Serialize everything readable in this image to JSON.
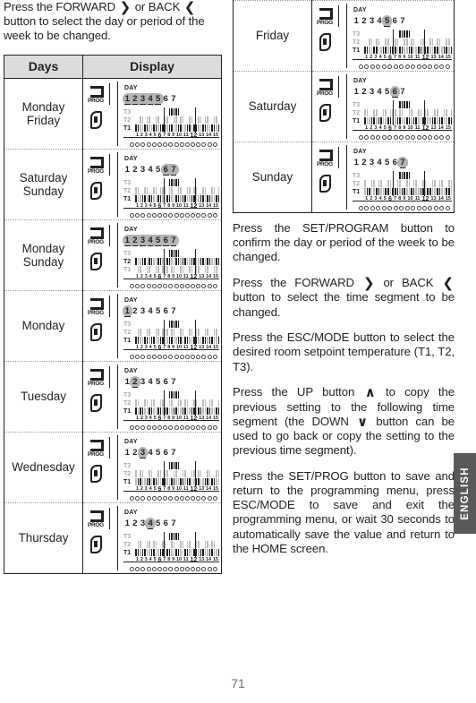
{
  "page_number": "71",
  "side_tab": {
    "label": "ENGLISH"
  },
  "left_column": {
    "intro_paragraph": {
      "part1": "Press the FORWARD",
      "icon_forward": "❯",
      "part2": "or BACK",
      "icon_back": "❮",
      "part3": "button to select the day or period of the week to be changed."
    },
    "table": {
      "headers": {
        "days": "Days",
        "display": "Display"
      },
      "rows": [
        {
          "days": "Monday\nFriday",
          "day_lines": [
            "Monday",
            "Friday"
          ],
          "display": {
            "prog_icon_label": "PROG",
            "day_label": "DAY",
            "day_numbers": [
              "1",
              "2",
              "3",
              "4",
              "5",
              "6",
              "7"
            ],
            "highlighted_days": [
              1,
              2,
              3,
              4,
              5
            ],
            "active_row": "T1",
            "rows": [
              "T3",
              "T2",
              "T1"
            ],
            "hour_ticks": [
              "1",
              "2",
              "3",
              "4",
              "5",
              "6",
              "7",
              "8",
              "9",
              "10",
              "11",
              "12",
              "13",
              "14",
              "15"
            ],
            "marker_hours": [
              "6",
              "12"
            ]
          }
        },
        {
          "days": "Saturday\nSunday",
          "day_lines": [
            "Saturday",
            "Sunday"
          ],
          "display": {
            "prog_icon_label": "PROG",
            "day_label": "DAY",
            "day_numbers": [
              "1",
              "2",
              "3",
              "4",
              "5",
              "6",
              "7"
            ],
            "highlighted_days": [
              6,
              7
            ],
            "active_row": "T1",
            "rows": [
              "T3",
              "T2",
              "T1"
            ],
            "hour_ticks": [
              "1",
              "2",
              "3",
              "4",
              "5",
              "6",
              "7",
              "8",
              "9",
              "10",
              "11",
              "12",
              "13",
              "14",
              "15"
            ],
            "marker_hours": [
              "6",
              "12"
            ]
          }
        },
        {
          "days": "Monday\nSunday",
          "day_lines": [
            "Monday",
            "Sunday"
          ],
          "display": {
            "prog_icon_label": "PROG",
            "day_label": "DAY",
            "day_numbers": [
              "1",
              "2",
              "3",
              "4",
              "5",
              "6",
              "7"
            ],
            "highlighted_days": [
              1,
              2,
              3,
              4,
              5,
              6,
              7
            ],
            "active_row": "T2",
            "rows": [
              "T3",
              "T2",
              "T1"
            ],
            "hour_ticks": [
              "1",
              "2",
              "3",
              "4",
              "5",
              "6",
              "7",
              "8",
              "9",
              "10",
              "11",
              "12",
              "13",
              "14",
              "15"
            ],
            "marker_hours": [
              "6",
              "12"
            ]
          }
        },
        {
          "days": "Monday",
          "day_lines": [
            "Monday"
          ],
          "display": {
            "prog_icon_label": "PROG",
            "day_label": "DAY",
            "day_numbers": [
              "1",
              "2",
              "3",
              "4",
              "5",
              "6",
              "7"
            ],
            "highlighted_days": [
              1
            ],
            "active_row": "T1",
            "rows": [
              "T3",
              "T2",
              "T1"
            ],
            "hour_ticks": [
              "1",
              "2",
              "3",
              "4",
              "5",
              "6",
              "7",
              "8",
              "9",
              "10",
              "11",
              "12",
              "13",
              "14",
              "15"
            ],
            "marker_hours": [
              "6",
              "12"
            ]
          }
        },
        {
          "days": "Tuesday",
          "day_lines": [
            "Tuesday"
          ],
          "display": {
            "prog_icon_label": "PROG",
            "day_label": "DAY",
            "day_numbers": [
              "1",
              "2",
              "3",
              "4",
              "5",
              "6",
              "7"
            ],
            "highlighted_days": [
              2
            ],
            "active_row": "T1",
            "rows": [
              "T3",
              "T2",
              "T1"
            ],
            "hour_ticks": [
              "1",
              "2",
              "3",
              "4",
              "5",
              "6",
              "7",
              "8",
              "9",
              "10",
              "11",
              "12",
              "13",
              "14",
              "15"
            ],
            "marker_hours": [
              "6",
              "12"
            ]
          }
        },
        {
          "days": "Wednesday",
          "day_lines": [
            "Wednesday"
          ],
          "display": {
            "prog_icon_label": "PROG",
            "day_label": "DAY",
            "day_numbers": [
              "1",
              "2",
              "3",
              "4",
              "5",
              "6",
              "7"
            ],
            "highlighted_days": [
              3
            ],
            "active_row": "T1",
            "rows": [
              "T3",
              "T2",
              "T1"
            ],
            "hour_ticks": [
              "1",
              "2",
              "3",
              "4",
              "5",
              "6",
              "7",
              "8",
              "9",
              "10",
              "11",
              "12",
              "13",
              "14",
              "15"
            ],
            "marker_hours": [
              "6",
              "12"
            ]
          }
        },
        {
          "days": "Thursday",
          "day_lines": [
            "Thursday"
          ],
          "display": {
            "prog_icon_label": "PROG",
            "day_label": "DAY",
            "day_numbers": [
              "1",
              "2",
              "3",
              "4",
              "5",
              "6",
              "7"
            ],
            "highlighted_days": [
              4
            ],
            "active_row": "T1",
            "rows": [
              "T3",
              "T2",
              "T1"
            ],
            "hour_ticks": [
              "1",
              "2",
              "3",
              "4",
              "5",
              "6",
              "7",
              "8",
              "9",
              "10",
              "11",
              "12",
              "13",
              "14",
              "15"
            ],
            "marker_hours": [
              "6",
              "12"
            ]
          }
        }
      ]
    }
  },
  "right_column": {
    "table_rows": [
      {
        "days": "Friday",
        "day_lines": [
          "Friday"
        ],
        "display": {
          "prog_icon_label": "PROG",
          "day_label": "DAY",
          "day_numbers": [
            "1",
            "2",
            "3",
            "4",
            "5",
            "6",
            "7"
          ],
          "highlighted_days": [
            5
          ],
          "active_row": "T1",
          "rows": [
            "T3",
            "T2",
            "T1"
          ],
          "hour_ticks": [
            "1",
            "2",
            "3",
            "4",
            "5",
            "6",
            "7",
            "8",
            "9",
            "10",
            "11",
            "12",
            "13",
            "14",
            "15"
          ],
          "marker_hours": [
            "6",
            "12"
          ]
        }
      },
      {
        "days": "Saturday",
        "day_lines": [
          "Saturday"
        ],
        "display": {
          "prog_icon_label": "PROG",
          "day_label": "DAY",
          "day_numbers": [
            "1",
            "2",
            "3",
            "4",
            "5",
            "6",
            "7"
          ],
          "highlighted_days": [
            6
          ],
          "active_row": "T1",
          "rows": [
            "T3",
            "T2",
            "T1"
          ],
          "hour_ticks": [
            "1",
            "2",
            "3",
            "4",
            "5",
            "6",
            "7",
            "8",
            "9",
            "10",
            "11",
            "12",
            "13",
            "14",
            "15"
          ],
          "marker_hours": [
            "6",
            "12"
          ]
        }
      },
      {
        "days": "Sunday",
        "day_lines": [
          "Sunday"
        ],
        "display": {
          "prog_icon_label": "PROG",
          "day_label": "DAY",
          "day_numbers": [
            "1",
            "2",
            "3",
            "4",
            "5",
            "6",
            "7"
          ],
          "highlighted_days": [
            7
          ],
          "active_row": "T1",
          "rows": [
            "T3",
            "T2",
            "T1"
          ],
          "hour_ticks": [
            "1",
            "2",
            "3",
            "4",
            "5",
            "6",
            "7",
            "8",
            "9",
            "10",
            "11",
            "12",
            "13",
            "14",
            "15"
          ],
          "marker_hours": [
            "6",
            "12"
          ]
        }
      }
    ],
    "paragraphs": [
      {
        "id": "p-confirm",
        "text": "Press the SET/PROGRAM button to confirm the day or period of the week to be changed."
      },
      {
        "id": "p-segment",
        "part1": "Press the FORWARD",
        "icon_forward": "❯",
        "part2": "or BACK",
        "icon_back": "❮",
        "part3": "button to select the  time segment to be changed."
      },
      {
        "id": "p-setpoint",
        "text": "Press the ESC/MODE button to select the desired room setpoint temperature (T1, T2, T3)."
      },
      {
        "id": "p-copy",
        "part1": "Press the UP button",
        "icon_up": "∧",
        "part2": "to copy the previous setting to the following time segment (the DOWN",
        "icon_down": "∨",
        "part3": "button can be used to go back or copy the setting to the previous time segment)."
      },
      {
        "id": "p-save",
        "text": "Press the SET/PROG button to save and return to the programming menu, press ESC/MODE to save and exit the programming menu, or wait 30 seconds to automatically save the value and return to the HOME screen."
      }
    ]
  }
}
